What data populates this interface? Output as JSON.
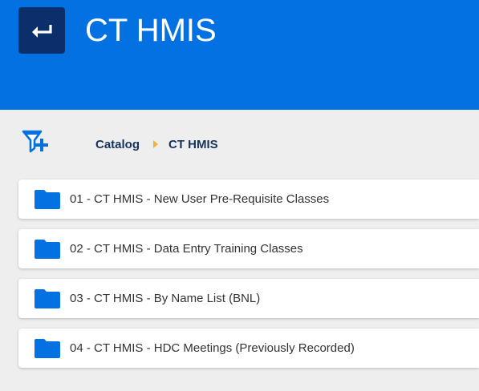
{
  "header": {
    "title": "CT HMIS",
    "back_icon": "back-arrow-icon",
    "background_color": "#0471e2",
    "back_button_color": "#0b2f6b"
  },
  "toolbar": {
    "filter_icon": "filter-add-icon"
  },
  "breadcrumb": {
    "items": [
      {
        "label": "Catalog"
      },
      {
        "label": "CT HMIS"
      }
    ],
    "separator_color": "#f5b335"
  },
  "catalog": {
    "item_icon": "folder-icon",
    "folder_color": "#0471e2",
    "items": [
      {
        "label": "01 - CT HMIS - New User Pre-Requisite Classes"
      },
      {
        "label": "02 - CT HMIS - Data Entry Training Classes"
      },
      {
        "label": "03 - CT HMIS - By Name List (BNL)"
      },
      {
        "label": "04 - CT HMIS - HDC Meetings (Previously Recorded)"
      }
    ]
  }
}
